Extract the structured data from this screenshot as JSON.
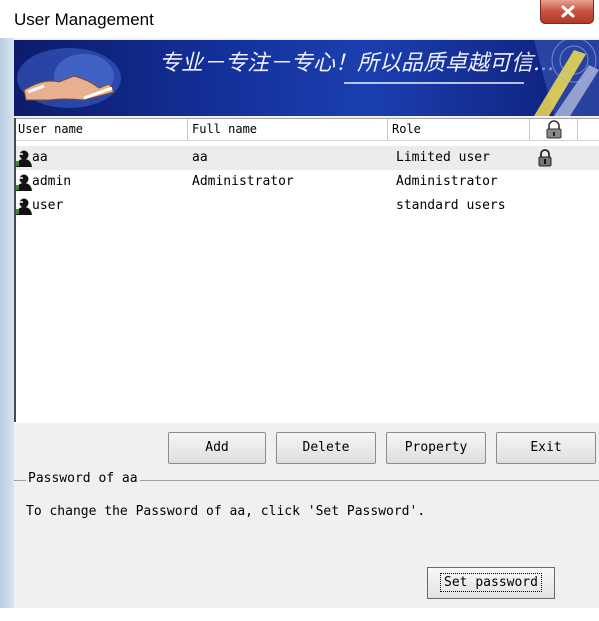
{
  "window": {
    "title": "User Management"
  },
  "banner": {
    "slogan": "专业－专注－专心！所以品质卓越可信..."
  },
  "list": {
    "columns": [
      "User name",
      "Full name",
      "Role",
      ""
    ],
    "rows": [
      {
        "user_name": "aa",
        "full_name": "aa",
        "role": "Limited user",
        "locked": true,
        "selected": true
      },
      {
        "user_name": "admin",
        "full_name": "Administrator",
        "role": "Administrator",
        "locked": false,
        "selected": false
      },
      {
        "user_name": "user",
        "full_name": "",
        "role": "standard users",
        "locked": false,
        "selected": false
      }
    ]
  },
  "buttons": {
    "add": "Add",
    "delete": "Delete",
    "property": "Property",
    "exit": "Exit"
  },
  "password": {
    "group_label": "Password of aa",
    "hint": "To change the Password of aa, click 'Set Password'.",
    "set_password": "Set password"
  },
  "colors": {
    "banner": "#13309a",
    "close_button": "#c85040",
    "selected_row": "#ececec"
  }
}
